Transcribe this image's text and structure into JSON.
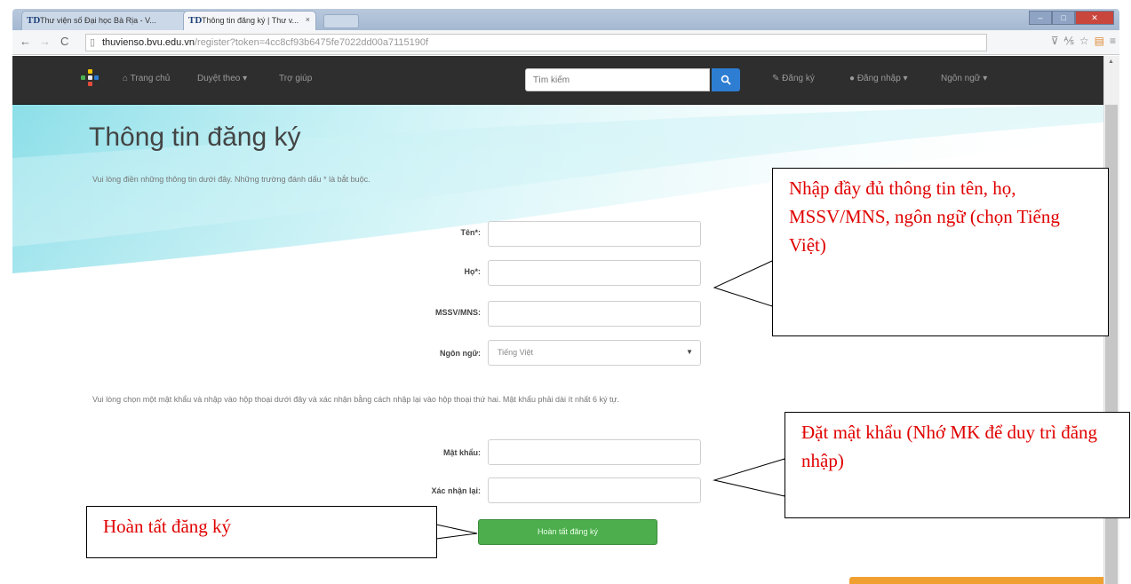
{
  "browser": {
    "tabs": [
      {
        "label": "Thư viện số Đại học Bà Rịa - V...",
        "favicon": "TD"
      },
      {
        "label": "Thông tin đăng ký | Thư v...",
        "favicon": "TD",
        "close": "×"
      }
    ],
    "address": {
      "host": "thuvienso.bvu.edu.vn",
      "path": "/register?token=4cc8cf93b6475fe7022dd00a7115190f"
    }
  },
  "navbar": {
    "home": "Trang chủ",
    "browse": "Duyệt theo ▾",
    "help": "Trợ giúp",
    "search_placeholder": "Tìm kiếm",
    "register": "Đăng ký",
    "login": "Đăng nhập ▾",
    "language": "Ngôn ngữ ▾"
  },
  "page": {
    "title": "Thông tin đăng ký",
    "intro": "Vui lòng điền những thông tin dưới đây. Những trường đánh dấu * là bắt buộc.",
    "fields": {
      "first_name": "Tên*:",
      "last_name": "Họ*:",
      "student_id": "MSSV/MNS:",
      "language": "Ngôn ngữ:",
      "language_value": "Tiếng Việt"
    },
    "password_intro": "Vui lòng chọn một mật khẩu và nhập vào hộp thoại dưới đây và xác nhận bằng cách nhập lại vào hộp thoại thứ hai. Mật khẩu phải dài ít nhất 6 ký tự.",
    "password_fields": {
      "password": "Mật khẩu:",
      "confirm": "Xác nhận lại:"
    },
    "submit": "Hoàn tất đăng ký"
  },
  "callouts": {
    "info": "Nhập đầy đủ thông tin tên, họ, MSSV/MNS, ngôn ngữ (chọn Tiếng Việt)",
    "password": "Đặt mật khẩu (Nhớ MK để duy trì đăng nhập)",
    "submit": "Hoàn tất đăng ký"
  },
  "colors": {
    "navbar_bg": "#2e2e2e",
    "search_button": "#2d7dd2",
    "submit_button": "#4cae4c",
    "callout_text": "#e00000"
  },
  "icons": {
    "home": "home-icon",
    "search": "search-icon",
    "register": "pencil-icon",
    "login": "user-icon"
  }
}
